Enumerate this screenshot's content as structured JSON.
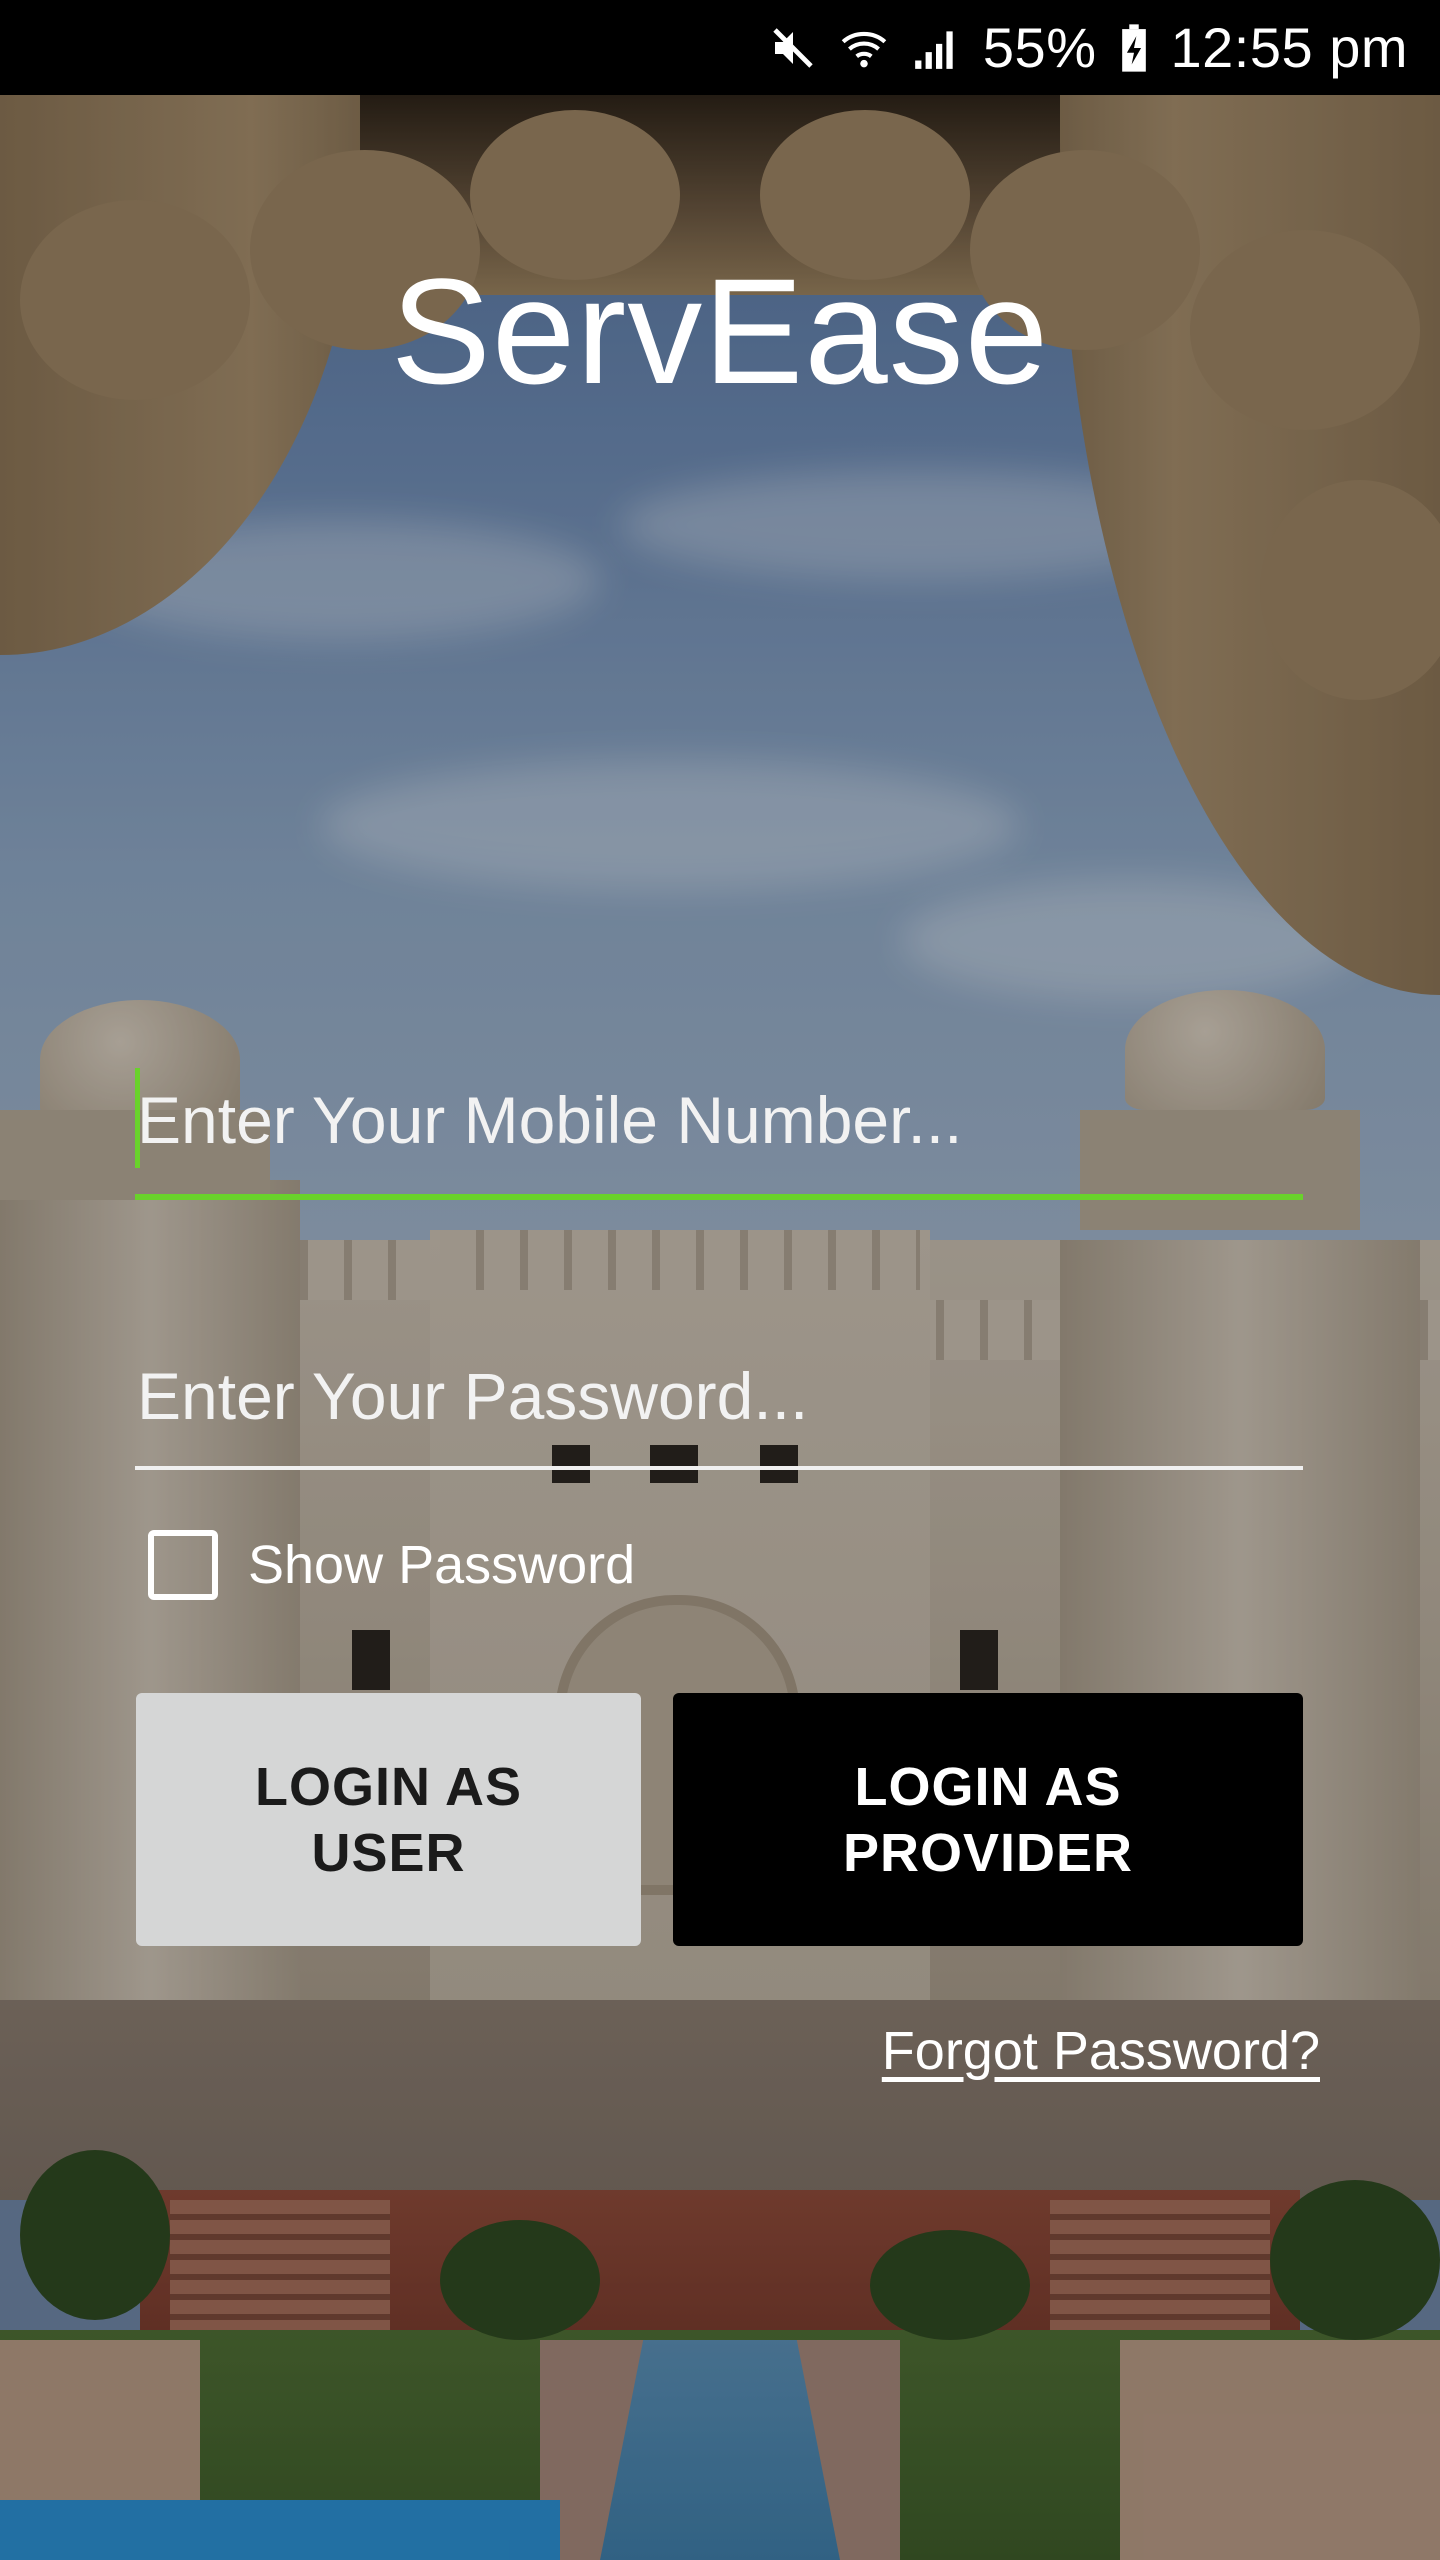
{
  "status_bar": {
    "battery": "55%",
    "time": "12:55 pm",
    "icons": [
      "mute-icon",
      "wifi-icon",
      "signal-icon",
      "battery-charging-icon"
    ]
  },
  "app": {
    "title": "ServEase"
  },
  "form": {
    "mobile_placeholder": "Enter Your Mobile Number...",
    "password_placeholder": "Enter Your Password...",
    "show_password_label": "Show Password",
    "show_password_checked": false,
    "login_user_label": "LOGIN AS\nUSER",
    "login_provider_label": "LOGIN AS\nPROVIDER",
    "forgot_password": "Forgot Password?"
  },
  "colors": {
    "accent_green": "#69d22b",
    "user_button_bg": "#d5d6d6",
    "provider_button_bg": "#000000",
    "text": "#ffffff"
  }
}
